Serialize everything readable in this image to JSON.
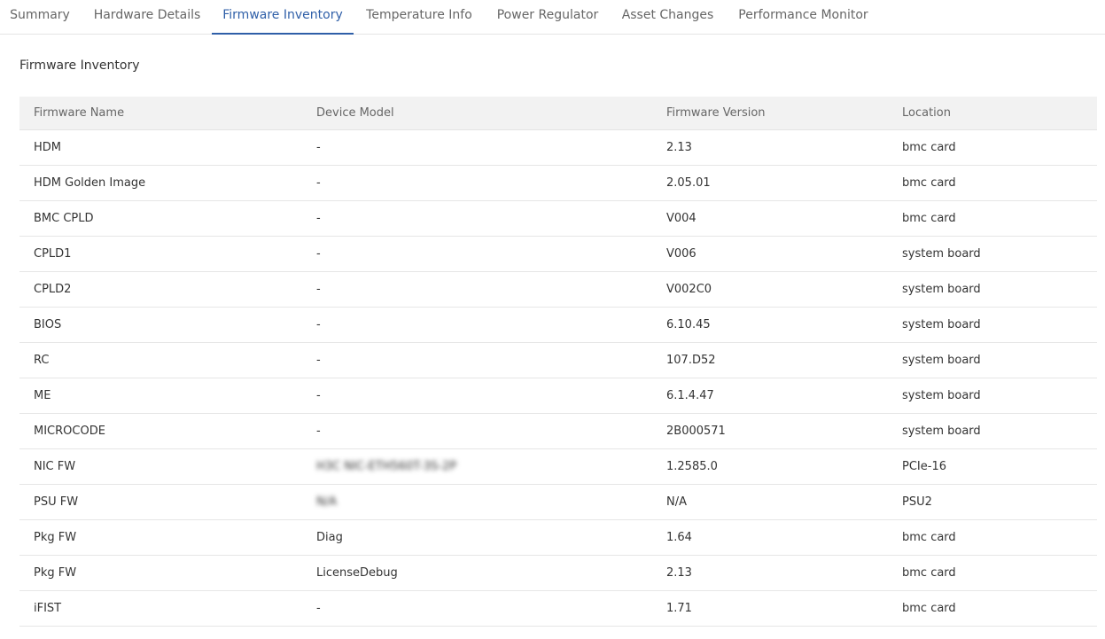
{
  "tabs": [
    {
      "label": "Summary"
    },
    {
      "label": "Hardware Details"
    },
    {
      "label": "Firmware Inventory",
      "active": true
    },
    {
      "label": "Temperature Info"
    },
    {
      "label": "Power Regulator"
    },
    {
      "label": "Asset Changes"
    },
    {
      "label": "Performance Monitor"
    }
  ],
  "section_title": "Firmware Inventory",
  "table": {
    "headers": [
      "Firmware Name",
      "Device Model",
      "Firmware Version",
      "Location"
    ],
    "rows": [
      [
        "HDM",
        "-",
        "2.13",
        "bmc card"
      ],
      [
        "HDM Golden Image",
        "-",
        "2.05.01",
        "bmc card"
      ],
      [
        "BMC CPLD",
        "-",
        "V004",
        "bmc card"
      ],
      [
        "CPLD1",
        "-",
        "V006",
        "system board"
      ],
      [
        "CPLD2",
        "-",
        "V002C0",
        "system board"
      ],
      [
        "BIOS",
        "-",
        "6.10.45",
        "system board"
      ],
      [
        "RC",
        "-",
        "107.D52",
        "system board"
      ],
      [
        "ME",
        "-",
        "6.1.4.47",
        "system board"
      ],
      [
        "MICROCODE",
        "-",
        "2B000571",
        "system board"
      ],
      [
        "NIC FW",
        "H3C NIC-ETH560T-3S-2P",
        "1.2585.0",
        "PCIe-16"
      ],
      [
        "PSU FW",
        "N/A",
        "N/A",
        "PSU2"
      ],
      [
        "Pkg FW",
        "Diag",
        "1.64",
        "bmc card"
      ],
      [
        "Pkg FW",
        "LicenseDebug",
        "2.13",
        "bmc card"
      ],
      [
        "iFIST",
        "-",
        "1.71",
        "bmc card"
      ]
    ]
  },
  "colors": {
    "accent": "#2f5fa8",
    "header_bg": "#f2f2f2",
    "divider": "#e6e6e6"
  }
}
